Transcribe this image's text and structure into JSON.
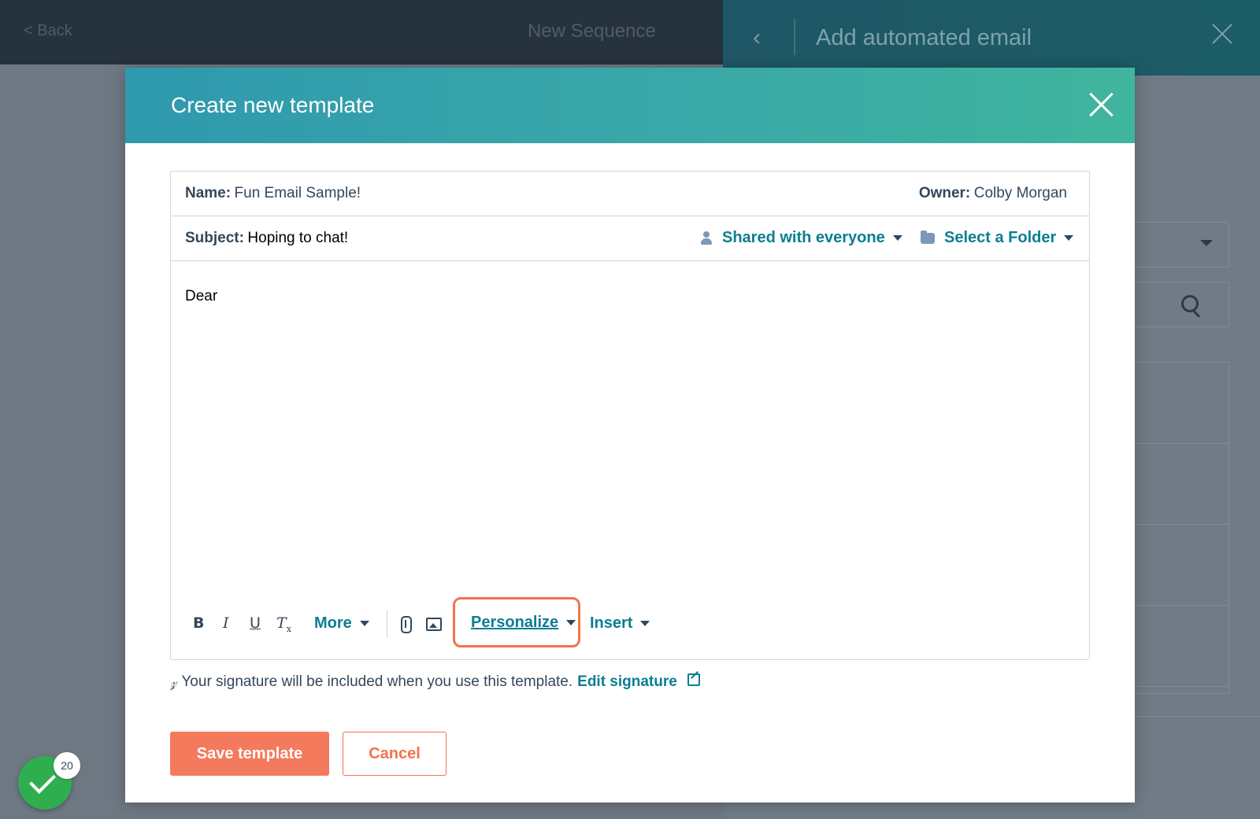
{
  "background": {
    "back_label": "< Back",
    "page_title": "New Sequence"
  },
  "side_panel": {
    "title": "Add automated email"
  },
  "modal": {
    "title": "Create new template",
    "name_label": "Name:",
    "name_value": "Fun Email Sample!",
    "owner_label": "Owner:",
    "owner_value": "Colby Morgan",
    "subject_label": "Subject:",
    "subject_value": "Hoping to chat!",
    "sharing_label": "Shared with everyone",
    "folder_label": "Select a Folder",
    "body_text": "Dear",
    "toolbar": {
      "bold": "B",
      "italic": "I",
      "underline": "U",
      "clear_format": "T",
      "clear_format_sub": "x",
      "more": "More",
      "personalize": "Personalize",
      "insert": "Insert"
    },
    "signature_text": "Your signature will be included when you use this template.",
    "edit_signature": "Edit signature",
    "save_button": "Save template",
    "cancel_button": "Cancel"
  },
  "task_badge": {
    "count": "20"
  },
  "colors": {
    "header_gradient_start": "#2f99ae",
    "header_gradient_end": "#40b59d",
    "primary_link": "#0b7e92",
    "save_button": "#f47a5e",
    "highlight_outline": "#f2734b",
    "task_badge": "#2fae4f"
  }
}
